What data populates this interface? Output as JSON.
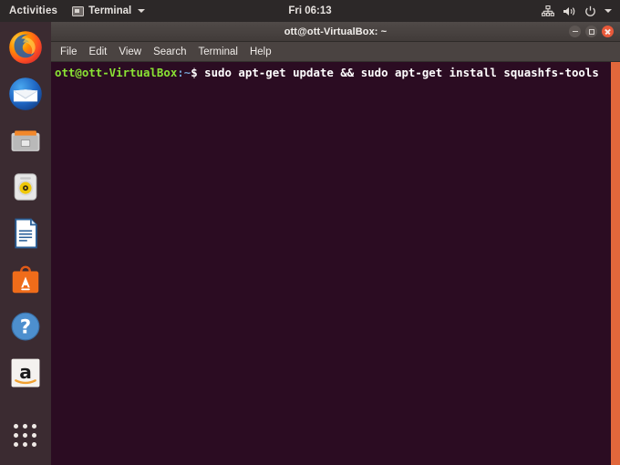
{
  "topbar": {
    "activities": "Activities",
    "app_menu_label": "Terminal",
    "app_menu_icon": "terminal-icon",
    "clock": "Fri 06:13",
    "tray": [
      {
        "name": "network-icon",
        "label": "Network"
      },
      {
        "name": "volume-icon",
        "label": "Volume"
      },
      {
        "name": "power-icon",
        "label": "Power"
      },
      {
        "name": "chevron-down-icon",
        "label": "System menu"
      }
    ]
  },
  "dock": {
    "items": [
      {
        "name": "firefox",
        "label": "Firefox Web Browser"
      },
      {
        "name": "thunderbird",
        "label": "Thunderbird Mail"
      },
      {
        "name": "files",
        "label": "Files"
      },
      {
        "name": "rhythmbox",
        "label": "Rhythmbox"
      },
      {
        "name": "libreoffice-writer",
        "label": "LibreOffice Writer"
      },
      {
        "name": "ubuntu-software",
        "label": "Ubuntu Software"
      },
      {
        "name": "help",
        "label": "Help"
      },
      {
        "name": "amazon",
        "label": "Amazon"
      }
    ],
    "show_applications_label": "Show Applications"
  },
  "window": {
    "title": "ott@ott-VirtualBox: ~",
    "buttons": {
      "minimize": "Minimize",
      "maximize": "Maximize",
      "close": "Close"
    },
    "menu": [
      "File",
      "Edit",
      "View",
      "Search",
      "Terminal",
      "Help"
    ]
  },
  "terminal": {
    "prompt_user": "ott@ott-VirtualBox",
    "prompt_path": ":~",
    "prompt_symbol": "$ ",
    "command": "sudo apt-get update && sudo apt-get install squashfs-tools",
    "colors": {
      "background": "#2b0c22",
      "prompt_user": "#8ae234",
      "prompt_path": "#729fcf",
      "text": "#ffffff",
      "scrollbar": "#e2673b"
    }
  }
}
